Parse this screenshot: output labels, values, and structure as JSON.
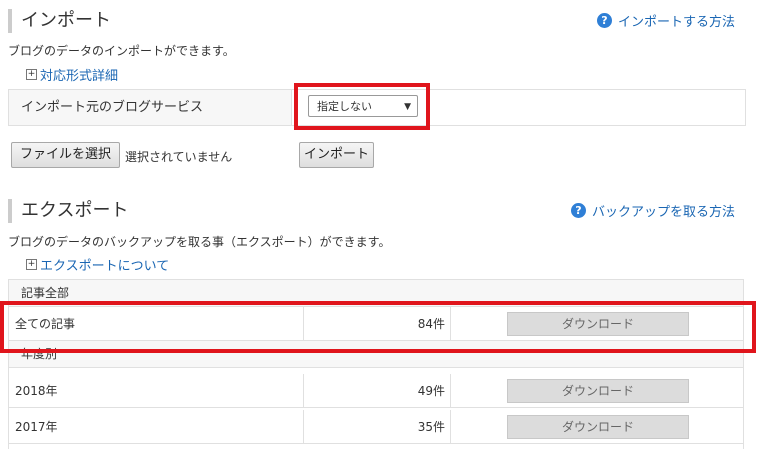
{
  "import": {
    "title": "インポート",
    "help_link": "インポートする方法",
    "description": "ブログのデータのインポートができます。",
    "formats_link": "対応形式詳細",
    "source_label": "インポート元のブログサービス",
    "select_value": "指定しない",
    "file_button": "ファイルを選択",
    "file_status": "選択されていません",
    "submit_button": "インポート"
  },
  "export": {
    "title": "エクスポート",
    "help_link": "バックアップを取る方法",
    "description": "ブログのデータのバックアップを取る事（エクスポート）ができます。",
    "about_link": "エクスポートについて",
    "all_group": "記事全部",
    "all_row": {
      "name": "全ての記事",
      "count": "84件",
      "button": "ダウンロード"
    },
    "year_group": "年度別",
    "year_rows": [
      {
        "name": "2018年",
        "count": "49件",
        "button": "ダウンロード"
      },
      {
        "name": "2017年",
        "count": "35件",
        "button": "ダウンロード"
      }
    ]
  },
  "icons": {
    "help": "question-circle-icon",
    "expand": "plus-square-icon",
    "dropdown": "caret-down-icon"
  },
  "colors": {
    "link": "#1a66b3",
    "highlight": "#e0151c",
    "help_icon": "#2f7fd6"
  }
}
